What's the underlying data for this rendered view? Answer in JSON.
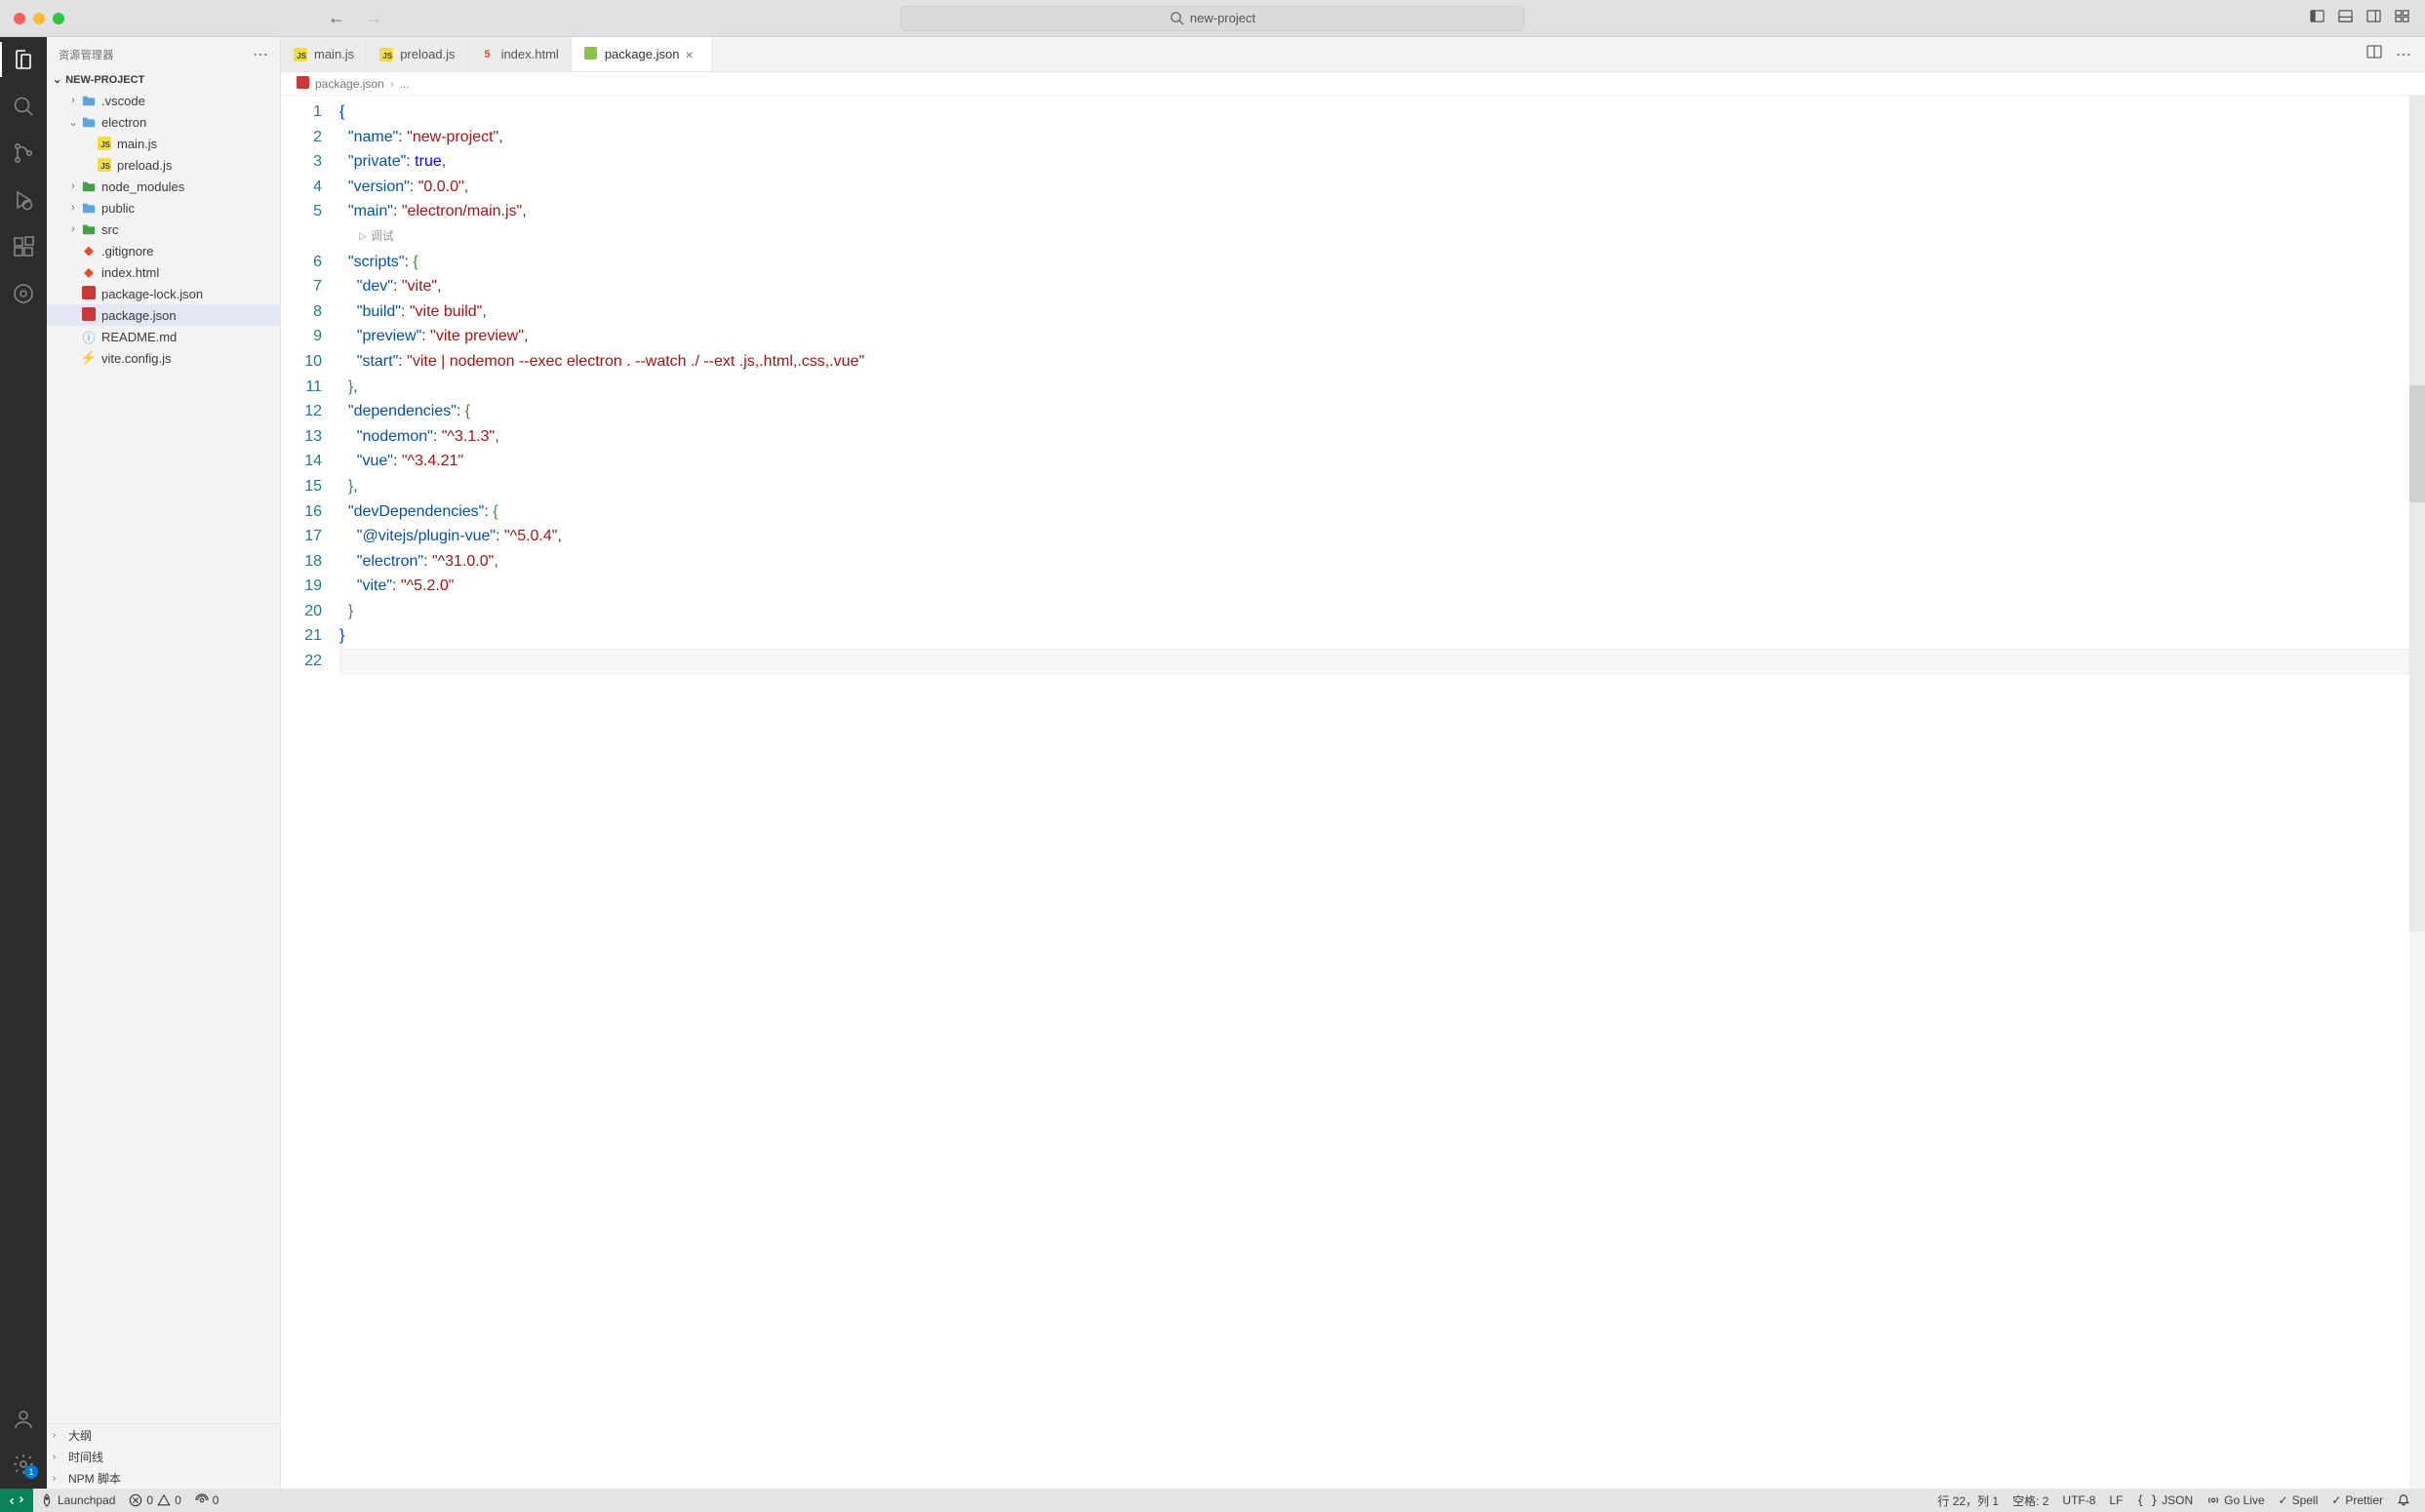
{
  "window": {
    "search_text": "new-project"
  },
  "sidebar": {
    "title": "资源管理器",
    "project": "NEW-PROJECT",
    "tree": [
      {
        "label": ".vscode",
        "type": "folder",
        "indent": 1,
        "open": false
      },
      {
        "label": "electron",
        "type": "folder",
        "indent": 1,
        "open": true
      },
      {
        "label": "main.js",
        "type": "js",
        "indent": 2
      },
      {
        "label": "preload.js",
        "type": "js",
        "indent": 2
      },
      {
        "label": "node_modules",
        "type": "folder-green",
        "indent": 1,
        "open": false
      },
      {
        "label": "public",
        "type": "folder",
        "indent": 1,
        "open": false
      },
      {
        "label": "src",
        "type": "folder-green",
        "indent": 1,
        "open": false
      },
      {
        "label": ".gitignore",
        "type": "git",
        "indent": 1
      },
      {
        "label": "index.html",
        "type": "html",
        "indent": 1
      },
      {
        "label": "package-lock.json",
        "type": "npm",
        "indent": 1
      },
      {
        "label": "package.json",
        "type": "npm",
        "indent": 1,
        "selected": true
      },
      {
        "label": "README.md",
        "type": "md",
        "indent": 1
      },
      {
        "label": "vite.config.js",
        "type": "vite",
        "indent": 1
      }
    ],
    "sections": [
      {
        "label": "大纲"
      },
      {
        "label": "时间线"
      },
      {
        "label": "NPM 脚本"
      }
    ]
  },
  "tabs": [
    {
      "label": "main.js",
      "icon": "js"
    },
    {
      "label": "preload.js",
      "icon": "js"
    },
    {
      "label": "index.html",
      "icon": "html"
    },
    {
      "label": "package.json",
      "icon": "npm",
      "active": true,
      "close": true
    }
  ],
  "breadcrumb": {
    "file": "package.json",
    "extra": "..."
  },
  "codelens": "调试",
  "code_lines": [
    {
      "n": 1,
      "tokens": [
        {
          "t": "{",
          "c": "brace"
        }
      ]
    },
    {
      "n": 2,
      "tokens": [
        {
          "t": "  ",
          "c": ""
        },
        {
          "t": "\"name\"",
          "c": "key"
        },
        {
          "t": ": ",
          "c": "punc"
        },
        {
          "t": "\"new-project\"",
          "c": "str"
        },
        {
          "t": ",",
          "c": "punc"
        }
      ]
    },
    {
      "n": 3,
      "tokens": [
        {
          "t": "  ",
          "c": ""
        },
        {
          "t": "\"private\"",
          "c": "key"
        },
        {
          "t": ": ",
          "c": "punc"
        },
        {
          "t": "true",
          "c": "bool"
        },
        {
          "t": ",",
          "c": "punc"
        }
      ]
    },
    {
      "n": 4,
      "tokens": [
        {
          "t": "  ",
          "c": ""
        },
        {
          "t": "\"version\"",
          "c": "key"
        },
        {
          "t": ": ",
          "c": "punc"
        },
        {
          "t": "\"0.0.0\"",
          "c": "str"
        },
        {
          "t": ",",
          "c": "punc"
        }
      ]
    },
    {
      "n": 5,
      "tokens": [
        {
          "t": "  ",
          "c": ""
        },
        {
          "t": "\"main\"",
          "c": "key"
        },
        {
          "t": ": ",
          "c": "punc"
        },
        {
          "t": "\"electron/main.js\"",
          "c": "str"
        },
        {
          "t": ",",
          "c": "punc"
        }
      ]
    },
    {
      "codelens": true
    },
    {
      "n": 6,
      "tokens": [
        {
          "t": "  ",
          "c": ""
        },
        {
          "t": "\"scripts\"",
          "c": "key"
        },
        {
          "t": ": ",
          "c": "punc"
        },
        {
          "t": "{",
          "c": "brace2"
        }
      ]
    },
    {
      "n": 7,
      "tokens": [
        {
          "t": "    ",
          "c": ""
        },
        {
          "t": "\"dev\"",
          "c": "key"
        },
        {
          "t": ": ",
          "c": "punc"
        },
        {
          "t": "\"vite\"",
          "c": "str"
        },
        {
          "t": ",",
          "c": "punc"
        }
      ]
    },
    {
      "n": 8,
      "tokens": [
        {
          "t": "    ",
          "c": ""
        },
        {
          "t": "\"build\"",
          "c": "key"
        },
        {
          "t": ": ",
          "c": "punc"
        },
        {
          "t": "\"vite build\"",
          "c": "str"
        },
        {
          "t": ",",
          "c": "punc"
        }
      ]
    },
    {
      "n": 9,
      "tokens": [
        {
          "t": "    ",
          "c": ""
        },
        {
          "t": "\"preview\"",
          "c": "key"
        },
        {
          "t": ": ",
          "c": "punc"
        },
        {
          "t": "\"vite preview\"",
          "c": "str"
        },
        {
          "t": ",",
          "c": "punc"
        }
      ]
    },
    {
      "n": 10,
      "tokens": [
        {
          "t": "    ",
          "c": ""
        },
        {
          "t": "\"start\"",
          "c": "key"
        },
        {
          "t": ": ",
          "c": "punc"
        },
        {
          "t": "\"vite | nodemon --exec electron . --watch ./ --ext .js,.html,.css,.vue\"",
          "c": "str"
        }
      ]
    },
    {
      "n": 11,
      "tokens": [
        {
          "t": "  ",
          "c": ""
        },
        {
          "t": "}",
          "c": "brace2"
        },
        {
          "t": ",",
          "c": "punc"
        }
      ]
    },
    {
      "n": 12,
      "tokens": [
        {
          "t": "  ",
          "c": ""
        },
        {
          "t": "\"dependencies\"",
          "c": "key"
        },
        {
          "t": ": ",
          "c": "punc"
        },
        {
          "t": "{",
          "c": "brace2"
        }
      ]
    },
    {
      "n": 13,
      "tokens": [
        {
          "t": "    ",
          "c": ""
        },
        {
          "t": "\"nodemon\"",
          "c": "key"
        },
        {
          "t": ": ",
          "c": "punc"
        },
        {
          "t": "\"^3.1.3\"",
          "c": "str"
        },
        {
          "t": ",",
          "c": "punc"
        }
      ]
    },
    {
      "n": 14,
      "tokens": [
        {
          "t": "    ",
          "c": ""
        },
        {
          "t": "\"vue\"",
          "c": "key"
        },
        {
          "t": ": ",
          "c": "punc"
        },
        {
          "t": "\"^3.4.21\"",
          "c": "str"
        }
      ]
    },
    {
      "n": 15,
      "tokens": [
        {
          "t": "  ",
          "c": ""
        },
        {
          "t": "}",
          "c": "brace2"
        },
        {
          "t": ",",
          "c": "punc"
        }
      ]
    },
    {
      "n": 16,
      "tokens": [
        {
          "t": "  ",
          "c": ""
        },
        {
          "t": "\"devDependencies\"",
          "c": "key"
        },
        {
          "t": ": ",
          "c": "punc"
        },
        {
          "t": "{",
          "c": "brace2"
        }
      ]
    },
    {
      "n": 17,
      "tokens": [
        {
          "t": "    ",
          "c": ""
        },
        {
          "t": "\"@vitejs/plugin-vue\"",
          "c": "key"
        },
        {
          "t": ": ",
          "c": "punc"
        },
        {
          "t": "\"^5.0.4\"",
          "c": "str"
        },
        {
          "t": ",",
          "c": "punc"
        }
      ]
    },
    {
      "n": 18,
      "tokens": [
        {
          "t": "    ",
          "c": ""
        },
        {
          "t": "\"electron\"",
          "c": "key"
        },
        {
          "t": ": ",
          "c": "punc"
        },
        {
          "t": "\"^31.0.0\"",
          "c": "str"
        },
        {
          "t": ",",
          "c": "punc"
        }
      ]
    },
    {
      "n": 19,
      "tokens": [
        {
          "t": "    ",
          "c": ""
        },
        {
          "t": "\"vite\"",
          "c": "key"
        },
        {
          "t": ": ",
          "c": "punc"
        },
        {
          "t": "\"^5.2.0\"",
          "c": "str"
        }
      ]
    },
    {
      "n": 20,
      "tokens": [
        {
          "t": "  ",
          "c": ""
        },
        {
          "t": "}",
          "c": "brace2"
        }
      ]
    },
    {
      "n": 21,
      "tokens": [
        {
          "t": "}",
          "c": "brace"
        }
      ]
    },
    {
      "n": 22,
      "current": true,
      "tokens": []
    }
  ],
  "status": {
    "launchpad": "Launchpad",
    "errors": "0",
    "warnings": "0",
    "ports": "0",
    "cursor": "行 22，列 1",
    "spaces": "空格: 2",
    "encoding": "UTF-8",
    "eol": "LF",
    "lang": "JSON",
    "golive": "Go Live",
    "spell": "Spell",
    "prettier": "Prettier"
  },
  "activity_badge": "1"
}
